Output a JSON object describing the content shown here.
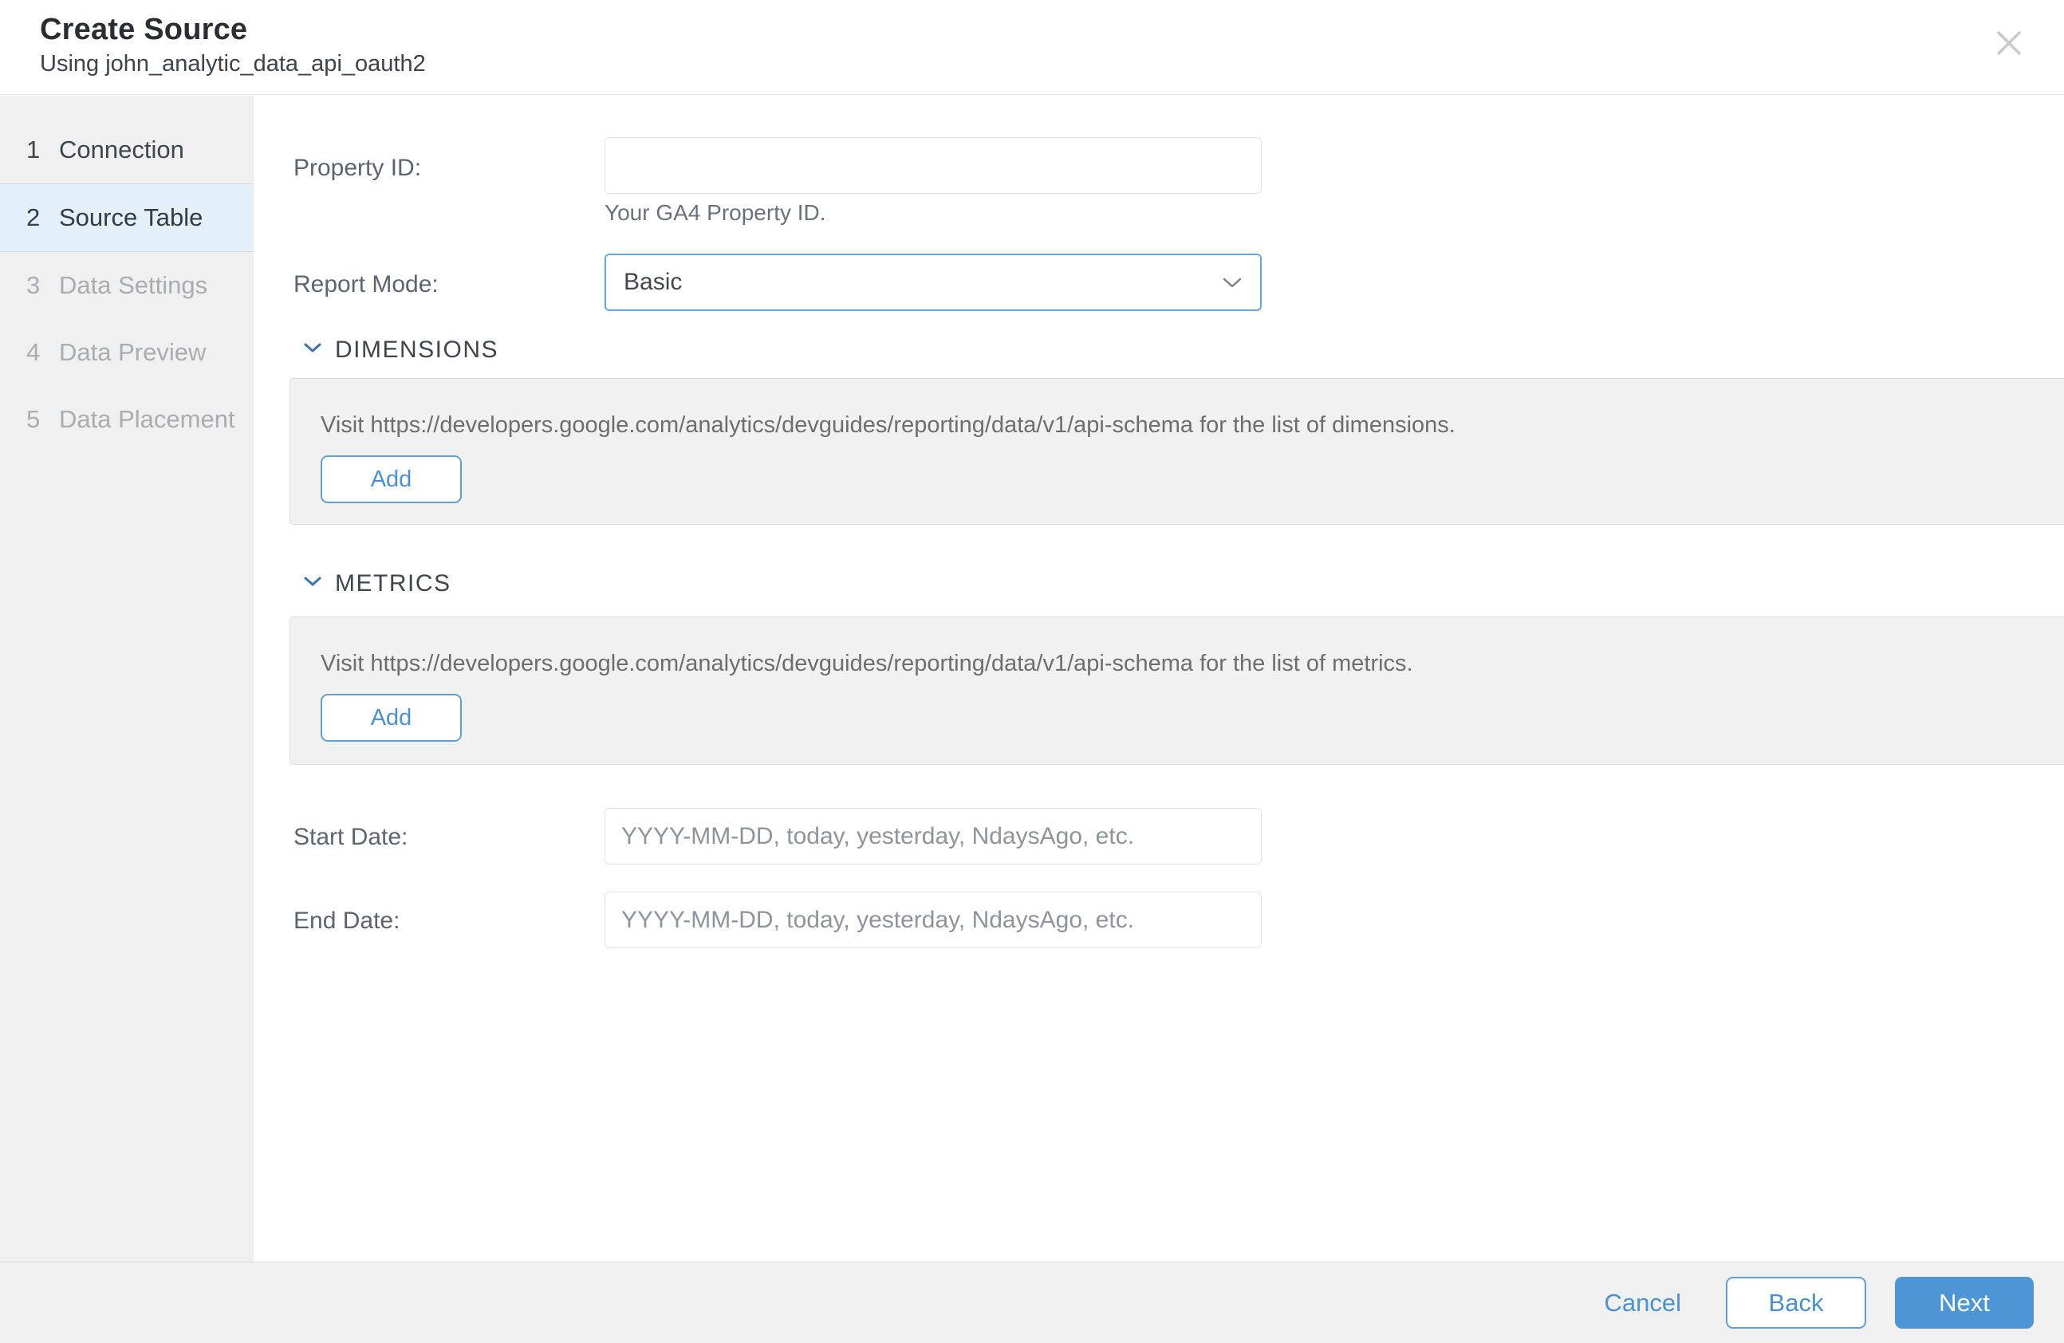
{
  "header": {
    "title": "Create Source",
    "subtitle": "Using john_analytic_data_api_oauth2"
  },
  "sidebar": {
    "steps": [
      {
        "number": "1",
        "label": "Connection",
        "state": "done"
      },
      {
        "number": "2",
        "label": "Source Table",
        "state": "active"
      },
      {
        "number": "3",
        "label": "Data Settings",
        "state": "pending"
      },
      {
        "number": "4",
        "label": "Data Preview",
        "state": "pending"
      },
      {
        "number": "5",
        "label": "Data Placement",
        "state": "pending"
      }
    ]
  },
  "form": {
    "property_id": {
      "label": "Property ID:",
      "value": "",
      "help": "Your GA4 Property ID."
    },
    "report_mode": {
      "label": "Report Mode:",
      "value": "Basic"
    },
    "dimensions": {
      "section_title": "DIMENSIONS",
      "info": "Visit https://developers.google.com/analytics/devguides/reporting/data/v1/api-schema for the list of dimensions.",
      "add_label": "Add"
    },
    "metrics": {
      "section_title": "METRICS",
      "info": "Visit https://developers.google.com/analytics/devguides/reporting/data/v1/api-schema for the list of metrics.",
      "add_label": "Add"
    },
    "start_date": {
      "label": "Start Date:",
      "placeholder": "YYYY-MM-DD, today, yesterday, NdaysAgo, etc."
    },
    "end_date": {
      "label": "End Date:",
      "placeholder": "YYYY-MM-DD, today, yesterday, NdaysAgo, etc."
    }
  },
  "footer": {
    "cancel_label": "Cancel",
    "back_label": "Back",
    "next_label": "Next"
  },
  "icons": {
    "close": "close-icon",
    "select_chevron": "chevron-down-icon",
    "section_chevron": "chevron-down-icon"
  },
  "colors": {
    "accent_text": "#4a90d2",
    "accent_border": "#5e9fd8",
    "accent_fill": "#4e95d6",
    "select_focus_border": "#64a7e0",
    "active_step_bg": "#e3f0fa",
    "chrome_bg": "#f0f0f0",
    "panel_bg": "#f1f1f1",
    "section_chevron_color": "#3c74ad",
    "close_icon_color": "#c9c9c9"
  }
}
